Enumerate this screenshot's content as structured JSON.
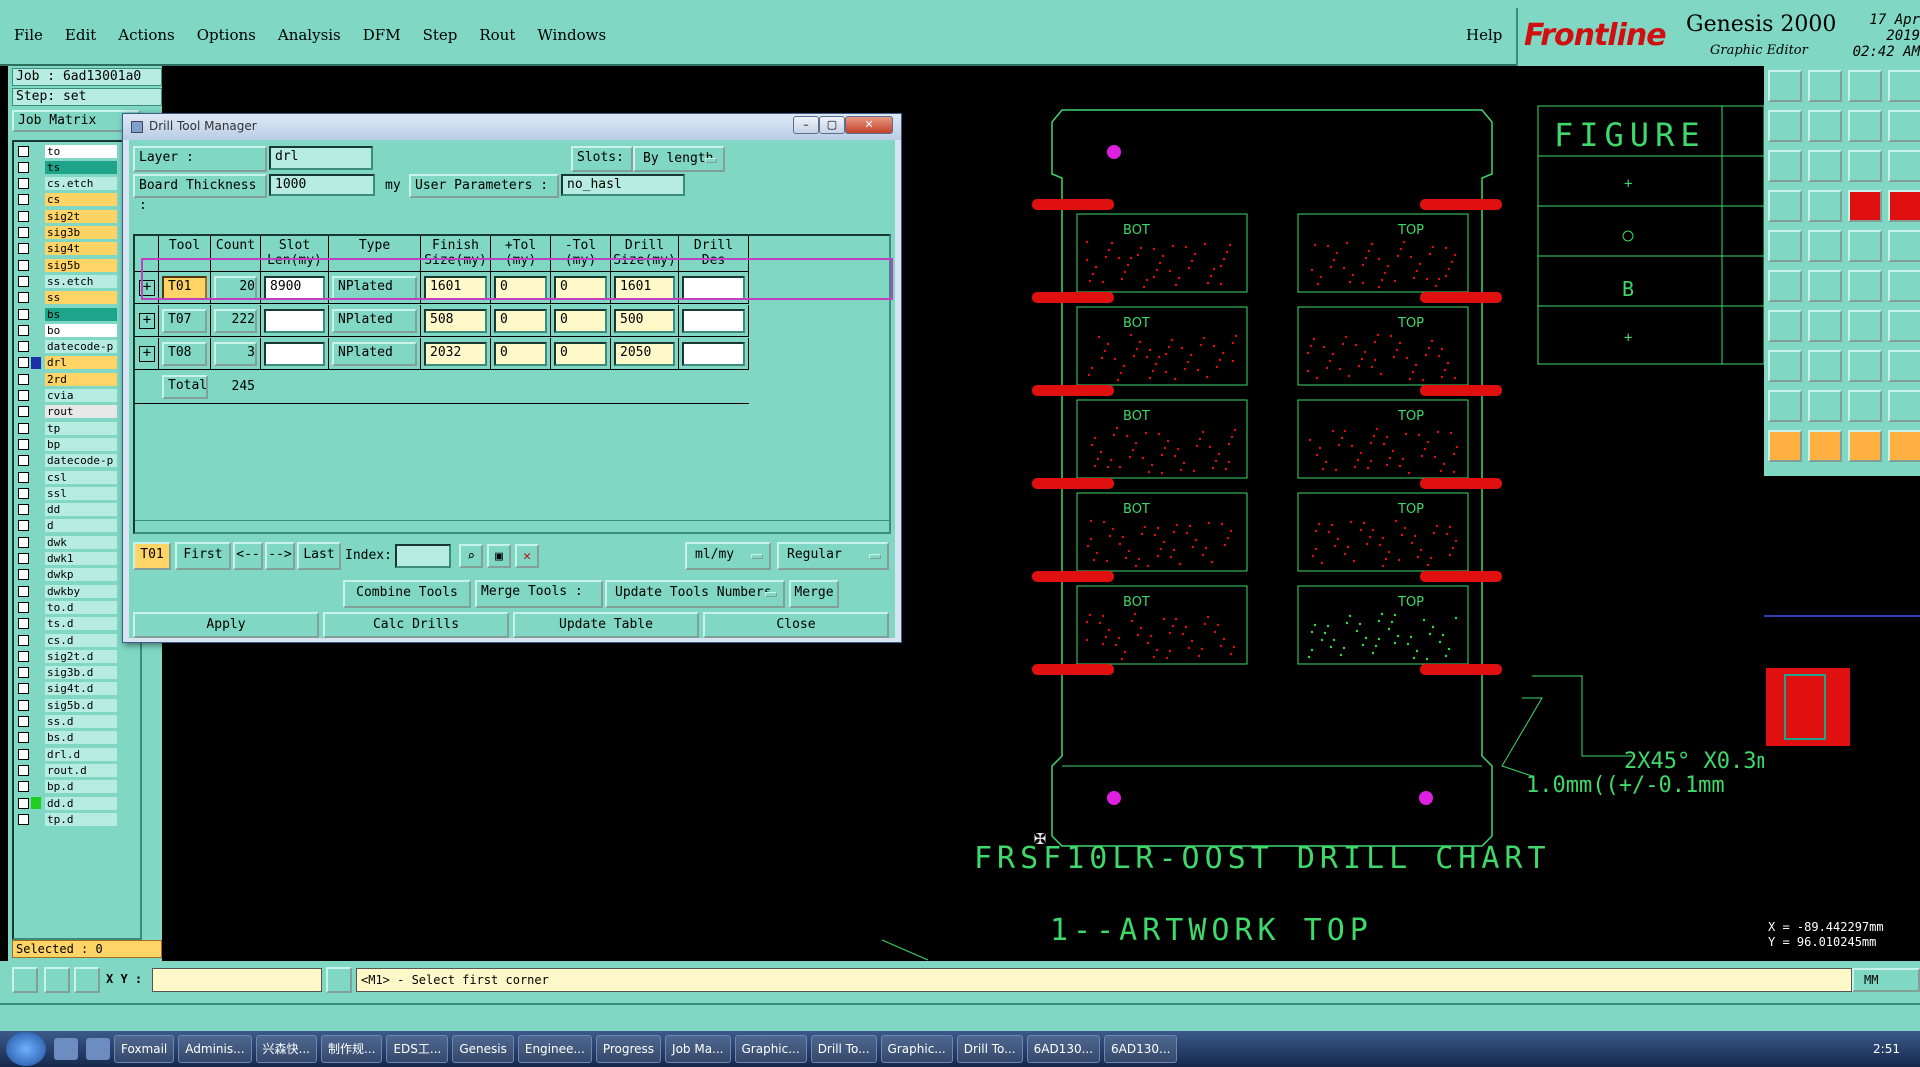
{
  "menubar": {
    "items": [
      "File",
      "Edit",
      "Actions",
      "Options",
      "Analysis",
      "DFM",
      "Step",
      "Rout",
      "Windows"
    ],
    "help": "Help"
  },
  "brand": {
    "logo_text": "Frontline",
    "product": "Genesis 2000",
    "subtitle": "Graphic Editor",
    "date": "17 Apr 2019",
    "time": "02:42 AM"
  },
  "left": {
    "job": "Job : 6ad13001a0",
    "step": "Step: set",
    "job_matrix": "Job Matrix",
    "selected": "Selected : 0",
    "layers": [
      {
        "name": "to",
        "color": "#ffffff"
      },
      {
        "name": "ts",
        "color": "#1fa48c"
      },
      {
        "name": "cs.etch",
        "color": "#b7ece1"
      },
      {
        "name": "cs",
        "color": "#ffd466"
      },
      {
        "name": "sig2t",
        "color": "#ffd466"
      },
      {
        "name": "sig3b",
        "color": "#ffd466"
      },
      {
        "name": "sig4t",
        "color": "#ffd466"
      },
      {
        "name": "sig5b",
        "color": "#ffd466"
      },
      {
        "name": "ss.etch",
        "color": "#b7ece1"
      },
      {
        "name": "ss",
        "color": "#ffd466"
      },
      {
        "name": "bs",
        "color": "#1fa48c"
      },
      {
        "name": "bo",
        "color": "#ffffff"
      },
      {
        "name": "datecode-p",
        "color": "#b7ece1"
      },
      {
        "name": "drl",
        "color": "#ffd466"
      },
      {
        "name": "2rd",
        "color": "#ffd466"
      },
      {
        "name": "cvia",
        "color": "#b7ece1"
      },
      {
        "name": "rout",
        "color": "#e8e8e8"
      },
      {
        "name": "tp",
        "color": "#b7ece1"
      },
      {
        "name": "bp",
        "color": "#b7ece1"
      },
      {
        "name": "datecode-p",
        "color": "#b7ece1"
      },
      {
        "name": "csl",
        "color": "#b7ece1"
      },
      {
        "name": "ssl",
        "color": "#b7ece1"
      },
      {
        "name": "dd",
        "color": "#b7ece1"
      },
      {
        "name": "d",
        "color": "#b7ece1"
      },
      {
        "name": "dwk",
        "color": "#b7ece1"
      },
      {
        "name": "dwk1",
        "color": "#b7ece1"
      },
      {
        "name": "dwkp",
        "color": "#b7ece1"
      },
      {
        "name": "dwkby",
        "color": "#b7ece1"
      },
      {
        "name": "to.d",
        "color": "#b7ece1"
      },
      {
        "name": "ts.d",
        "color": "#b7ece1"
      },
      {
        "name": "cs.d",
        "color": "#b7ece1"
      },
      {
        "name": "sig2t.d",
        "color": "#b7ece1"
      },
      {
        "name": "sig3b.d",
        "color": "#b7ece1"
      },
      {
        "name": "sig4t.d",
        "color": "#b7ece1"
      },
      {
        "name": "sig5b.d",
        "color": "#b7ece1"
      },
      {
        "name": "ss.d",
        "color": "#b7ece1"
      },
      {
        "name": "bs.d",
        "color": "#b7ece1"
      },
      {
        "name": "drl.d",
        "color": "#b7ece1"
      },
      {
        "name": "rout.d",
        "color": "#b7ece1"
      },
      {
        "name": "bp.d",
        "color": "#b7ece1"
      },
      {
        "name": "dd.d",
        "color": "#b7ece1"
      },
      {
        "name": "tp.d",
        "color": "#b7ece1"
      }
    ]
  },
  "drill_tool_manager": {
    "title": "Drill Tool Manager",
    "layer_label": "Layer :",
    "layer_value": "drl",
    "slots_label": "Slots:",
    "slots_value": "By length",
    "board_thickness_label": "Board Thickness :",
    "board_thickness_value": "1000",
    "board_thickness_unit": "my",
    "user_params_label": "User Parameters :",
    "user_params_value": "no_hasl",
    "columns": [
      "Tool",
      "Count",
      "Slot Len(my)",
      "Type",
      "Finish Size(my)",
      "+Tol (my)",
      "-Tol (my)",
      "Drill Size(my)",
      "Drill Des"
    ],
    "rows": [
      {
        "tool": "T01",
        "count": "20",
        "slot_len": "8900",
        "type": "NPlated",
        "finish": "1601",
        "ptol": "0",
        "mtol": "0",
        "drill": "1601",
        "des": ""
      },
      {
        "tool": "T07",
        "count": "222",
        "slot_len": "",
        "type": "NPlated",
        "finish": "508",
        "ptol": "0",
        "mtol": "0",
        "drill": "500",
        "des": ""
      },
      {
        "tool": "T08",
        "count": "3",
        "slot_len": "",
        "type": "NPlated",
        "finish": "2032",
        "ptol": "0",
        "mtol": "0",
        "drill": "2050",
        "des": ""
      }
    ],
    "total_label": "Total",
    "total_count": "245",
    "nav": {
      "current": "T01",
      "first": "First",
      "prev": "<--",
      "next": "-->",
      "last": "Last",
      "index_label": "Index:",
      "index_value": "",
      "units": "ml/my",
      "mode": "Regular"
    },
    "actions": {
      "combine": "Combine Tools",
      "merge_label": "Merge Tools :",
      "update_numbers": "Update Tools Numbers",
      "merge": "Merge"
    },
    "footer": {
      "apply": "Apply",
      "calc": "Calc Drills",
      "update_table": "Update Table",
      "close": "Close"
    }
  },
  "canvas": {
    "board_labels": [
      "BOT",
      "TOP",
      "BOT",
      "TOP",
      "BOT",
      "TOP",
      "BOT",
      "TOP",
      "BOT",
      "TOP"
    ],
    "title": "FRSF10LR-OOST DRILL CHART",
    "subtitle": "1--ARTWORK TOP",
    "figure": "FIGURE",
    "dim1": "2X45° X0.3m",
    "dim2": "1.0mm((+/-0.1mm"
  },
  "coords": {
    "x": "X = -89.442297mm",
    "y": "Y = 96.010245mm"
  },
  "bottom": {
    "xy_label": "X Y :",
    "xy_value": "",
    "message": "<M1> - Select first corner",
    "units": "MM"
  },
  "taskbar": {
    "items": [
      "Foxmail",
      "Adminis...",
      "兴森快...",
      "制作规...",
      "EDS工...",
      "Genesis",
      "Enginee...",
      "Progress",
      "Job Ma...",
      "Graphic...",
      "Drill To...",
      "Graphic...",
      "Drill To...",
      "6AD130...",
      "6AD130..."
    ],
    "clock": "2:51"
  },
  "colors": {
    "panel": "#7fd7c4",
    "field": "#b7ece1",
    "highlight": "#c040c0",
    "pad_red": "#e01010",
    "outline_green": "#3fd86a"
  }
}
